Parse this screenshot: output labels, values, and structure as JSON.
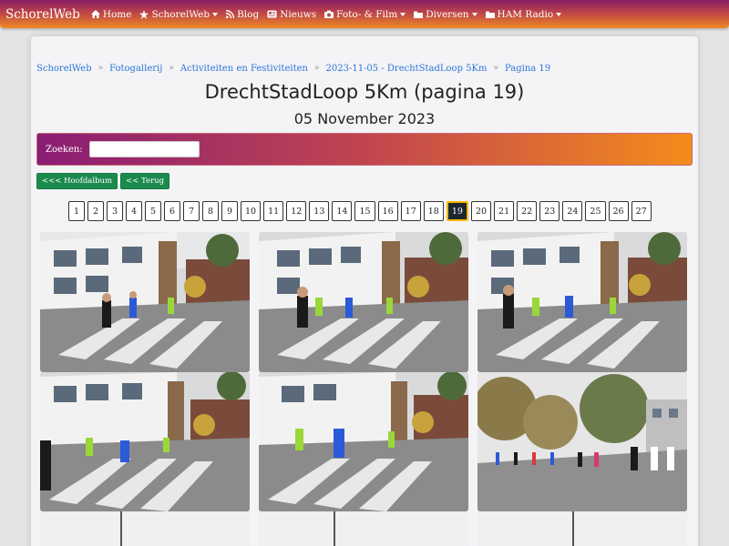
{
  "navbar": {
    "brand": "SchorelWeb",
    "items": [
      {
        "label": "Home",
        "icon": "home-icon",
        "dropdown": false
      },
      {
        "label": "SchorelWeb",
        "icon": "star-icon",
        "dropdown": true
      },
      {
        "label": "Blog",
        "icon": "rss-icon",
        "dropdown": false
      },
      {
        "label": "Nieuws",
        "icon": "newspaper-icon",
        "dropdown": false
      },
      {
        "label": "Foto- & Film",
        "icon": "camera-icon",
        "dropdown": true
      },
      {
        "label": "Diversen",
        "icon": "folder-icon",
        "dropdown": true
      },
      {
        "label": "HAM Radio",
        "icon": "folder-icon",
        "dropdown": true
      }
    ]
  },
  "breadcrumb": [
    "SchorelWeb",
    "Fotogallerij",
    "Activiteiten en Festiviteiten",
    "2023-11-05 - DrechtStadLoop 5Km",
    "Pagina 19"
  ],
  "title": "DrechtStadLoop 5Km (pagina 19)",
  "subtitle": "05 November 2023",
  "search": {
    "label": "Zoeken:",
    "value": "",
    "placeholder": ""
  },
  "buttons": {
    "main_album": "<<< Hoofdalbum",
    "back": "<< Terug"
  },
  "pagination": {
    "pages": [
      "1",
      "2",
      "3",
      "4",
      "5",
      "6",
      "7",
      "8",
      "9",
      "10",
      "11",
      "12",
      "13",
      "14",
      "15",
      "16",
      "17",
      "18",
      "19",
      "20",
      "21",
      "22",
      "23",
      "24",
      "25",
      "26",
      "27"
    ],
    "active": "19"
  },
  "colors": {
    "nav_gradient_start": "#8a1d66",
    "nav_gradient_end": "#ef8a23",
    "link": "#2a76d8",
    "button_green": "#1b8a4d",
    "active_page": "#1c2732"
  }
}
